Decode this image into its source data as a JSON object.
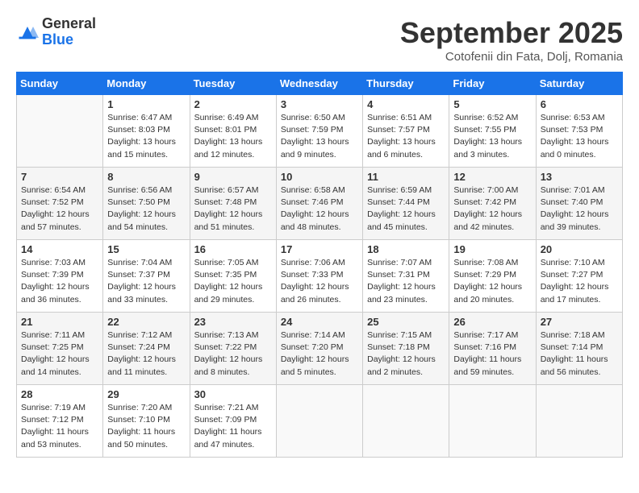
{
  "logo": {
    "general": "General",
    "blue": "Blue"
  },
  "header": {
    "month": "September 2025",
    "location": "Cotofenii din Fata, Dolj, Romania"
  },
  "days_of_week": [
    "Sunday",
    "Monday",
    "Tuesday",
    "Wednesday",
    "Thursday",
    "Friday",
    "Saturday"
  ],
  "weeks": [
    [
      {
        "day": "",
        "info": ""
      },
      {
        "day": "1",
        "info": "Sunrise: 6:47 AM\nSunset: 8:03 PM\nDaylight: 13 hours\nand 15 minutes."
      },
      {
        "day": "2",
        "info": "Sunrise: 6:49 AM\nSunset: 8:01 PM\nDaylight: 13 hours\nand 12 minutes."
      },
      {
        "day": "3",
        "info": "Sunrise: 6:50 AM\nSunset: 7:59 PM\nDaylight: 13 hours\nand 9 minutes."
      },
      {
        "day": "4",
        "info": "Sunrise: 6:51 AM\nSunset: 7:57 PM\nDaylight: 13 hours\nand 6 minutes."
      },
      {
        "day": "5",
        "info": "Sunrise: 6:52 AM\nSunset: 7:55 PM\nDaylight: 13 hours\nand 3 minutes."
      },
      {
        "day": "6",
        "info": "Sunrise: 6:53 AM\nSunset: 7:53 PM\nDaylight: 13 hours\nand 0 minutes."
      }
    ],
    [
      {
        "day": "7",
        "info": "Sunrise: 6:54 AM\nSunset: 7:52 PM\nDaylight: 12 hours\nand 57 minutes."
      },
      {
        "day": "8",
        "info": "Sunrise: 6:56 AM\nSunset: 7:50 PM\nDaylight: 12 hours\nand 54 minutes."
      },
      {
        "day": "9",
        "info": "Sunrise: 6:57 AM\nSunset: 7:48 PM\nDaylight: 12 hours\nand 51 minutes."
      },
      {
        "day": "10",
        "info": "Sunrise: 6:58 AM\nSunset: 7:46 PM\nDaylight: 12 hours\nand 48 minutes."
      },
      {
        "day": "11",
        "info": "Sunrise: 6:59 AM\nSunset: 7:44 PM\nDaylight: 12 hours\nand 45 minutes."
      },
      {
        "day": "12",
        "info": "Sunrise: 7:00 AM\nSunset: 7:42 PM\nDaylight: 12 hours\nand 42 minutes."
      },
      {
        "day": "13",
        "info": "Sunrise: 7:01 AM\nSunset: 7:40 PM\nDaylight: 12 hours\nand 39 minutes."
      }
    ],
    [
      {
        "day": "14",
        "info": "Sunrise: 7:03 AM\nSunset: 7:39 PM\nDaylight: 12 hours\nand 36 minutes."
      },
      {
        "day": "15",
        "info": "Sunrise: 7:04 AM\nSunset: 7:37 PM\nDaylight: 12 hours\nand 33 minutes."
      },
      {
        "day": "16",
        "info": "Sunrise: 7:05 AM\nSunset: 7:35 PM\nDaylight: 12 hours\nand 29 minutes."
      },
      {
        "day": "17",
        "info": "Sunrise: 7:06 AM\nSunset: 7:33 PM\nDaylight: 12 hours\nand 26 minutes."
      },
      {
        "day": "18",
        "info": "Sunrise: 7:07 AM\nSunset: 7:31 PM\nDaylight: 12 hours\nand 23 minutes."
      },
      {
        "day": "19",
        "info": "Sunrise: 7:08 AM\nSunset: 7:29 PM\nDaylight: 12 hours\nand 20 minutes."
      },
      {
        "day": "20",
        "info": "Sunrise: 7:10 AM\nSunset: 7:27 PM\nDaylight: 12 hours\nand 17 minutes."
      }
    ],
    [
      {
        "day": "21",
        "info": "Sunrise: 7:11 AM\nSunset: 7:25 PM\nDaylight: 12 hours\nand 14 minutes."
      },
      {
        "day": "22",
        "info": "Sunrise: 7:12 AM\nSunset: 7:24 PM\nDaylight: 12 hours\nand 11 minutes."
      },
      {
        "day": "23",
        "info": "Sunrise: 7:13 AM\nSunset: 7:22 PM\nDaylight: 12 hours\nand 8 minutes."
      },
      {
        "day": "24",
        "info": "Sunrise: 7:14 AM\nSunset: 7:20 PM\nDaylight: 12 hours\nand 5 minutes."
      },
      {
        "day": "25",
        "info": "Sunrise: 7:15 AM\nSunset: 7:18 PM\nDaylight: 12 hours\nand 2 minutes."
      },
      {
        "day": "26",
        "info": "Sunrise: 7:17 AM\nSunset: 7:16 PM\nDaylight: 11 hours\nand 59 minutes."
      },
      {
        "day": "27",
        "info": "Sunrise: 7:18 AM\nSunset: 7:14 PM\nDaylight: 11 hours\nand 56 minutes."
      }
    ],
    [
      {
        "day": "28",
        "info": "Sunrise: 7:19 AM\nSunset: 7:12 PM\nDaylight: 11 hours\nand 53 minutes."
      },
      {
        "day": "29",
        "info": "Sunrise: 7:20 AM\nSunset: 7:10 PM\nDaylight: 11 hours\nand 50 minutes."
      },
      {
        "day": "30",
        "info": "Sunrise: 7:21 AM\nSunset: 7:09 PM\nDaylight: 11 hours\nand 47 minutes."
      },
      {
        "day": "",
        "info": ""
      },
      {
        "day": "",
        "info": ""
      },
      {
        "day": "",
        "info": ""
      },
      {
        "day": "",
        "info": ""
      }
    ]
  ]
}
